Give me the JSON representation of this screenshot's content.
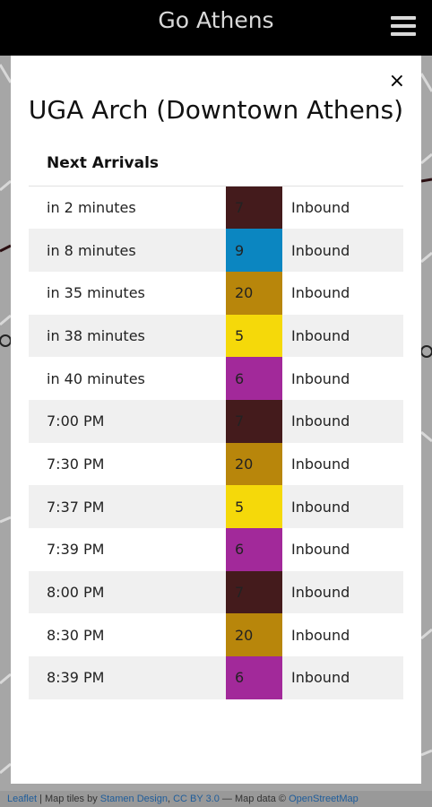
{
  "app": {
    "title": "Go Athens"
  },
  "modal": {
    "title": "UGA Arch (Downtown Athens)",
    "section_title": "Next Arrivals",
    "close_label": "×"
  },
  "route_colors": {
    "5": "#f5d90a",
    "6": "#a2299a",
    "7": "#441b1c",
    "9": "#0b86c1",
    "20": "#b8860b"
  },
  "arrivals": [
    {
      "time": "in 2 minutes",
      "route": "7",
      "direction": "Inbound"
    },
    {
      "time": "in 8 minutes",
      "route": "9",
      "direction": "Inbound"
    },
    {
      "time": "in 35 minutes",
      "route": "20",
      "direction": "Inbound"
    },
    {
      "time": "in 38 minutes",
      "route": "5",
      "direction": "Inbound"
    },
    {
      "time": "in 40 minutes",
      "route": "6",
      "direction": "Inbound"
    },
    {
      "time": "7:00 PM",
      "route": "7",
      "direction": "Inbound"
    },
    {
      "time": "7:30 PM",
      "route": "20",
      "direction": "Inbound"
    },
    {
      "time": "7:37 PM",
      "route": "5",
      "direction": "Inbound"
    },
    {
      "time": "7:39 PM",
      "route": "6",
      "direction": "Inbound"
    },
    {
      "time": "8:00 PM",
      "route": "7",
      "direction": "Inbound"
    },
    {
      "time": "8:30 PM",
      "route": "20",
      "direction": "Inbound"
    },
    {
      "time": "8:39 PM",
      "route": "6",
      "direction": "Inbound"
    }
  ],
  "attribution": {
    "leaflet": "Leaflet",
    "sep1": " | Map tiles by ",
    "stamen": "Stamen Design",
    "sep2": ", ",
    "license": "CC BY 3.0",
    "sep3": " — Map data © ",
    "osm": "OpenStreetMap"
  }
}
